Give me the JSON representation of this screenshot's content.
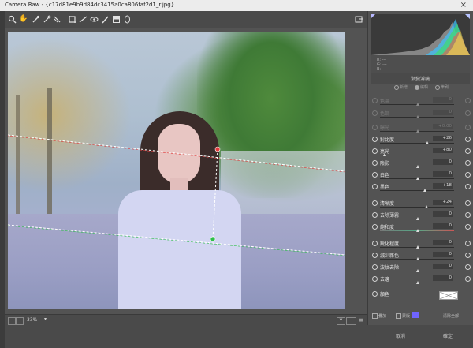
{
  "window": {
    "title": "Camera Raw - {c17d81e9b9d84dc3415a0ca806faf2d1_r.jpg}"
  },
  "toolbar": {
    "tools": [
      "zoom-icon",
      "hand-icon",
      "white-balance-icon",
      "color-sampler-icon",
      "targeted-adjust-icon",
      "crop-icon",
      "straighten-icon",
      "red-eye-icon",
      "brush-icon",
      "graduated-filter-icon",
      "radial-filter-icon"
    ]
  },
  "canvas": {
    "zoom": "33%"
  },
  "footer": {
    "cancel": "取消",
    "ok": "確定"
  },
  "panel": {
    "title": "漸變濾鏡",
    "modes": [
      "新增",
      "編輯",
      "筆刷"
    ],
    "sliders": [
      {
        "label": "色溫",
        "value": "0",
        "enabled": false
      },
      {
        "label": "色調",
        "value": "0",
        "enabled": false
      },
      {
        "label": "曝光",
        "value": "+0.00",
        "enabled": false
      },
      {
        "label": "對比度",
        "value": "+26",
        "enabled": true
      },
      {
        "label": "亮光",
        "value": "+80",
        "enabled": true
      },
      {
        "label": "陰影",
        "value": "0",
        "enabled": true
      },
      {
        "label": "白色",
        "value": "0",
        "enabled": true
      },
      {
        "label": "黑色",
        "value": "+18",
        "enabled": true
      },
      {
        "label": "清晰度",
        "value": "+24",
        "enabled": true
      },
      {
        "label": "去除薄霧",
        "value": "0",
        "enabled": true
      },
      {
        "label": "飽和度",
        "value": "0",
        "enabled": true
      },
      {
        "label": "銳化程度",
        "value": "0",
        "enabled": true
      },
      {
        "label": "減少雜色",
        "value": "0",
        "enabled": true
      },
      {
        "label": "波紋去除",
        "value": "0",
        "enabled": true
      },
      {
        "label": "去邊",
        "value": "0",
        "enabled": true
      },
      {
        "label": "顏色",
        "value": "",
        "enabled": true
      }
    ],
    "footer": {
      "overlay": "疊加",
      "mask": "蒙版",
      "clear": "清除全部"
    },
    "readout": {
      "r": "R: ---",
      "g": "G: ---",
      "b": "B: ---"
    }
  },
  "colors": {
    "mask_color": "#6f64ff",
    "clip_shadow": "#b8b8ff",
    "pin_red": "#e23b3b",
    "pin_green": "#2fbf4a"
  }
}
